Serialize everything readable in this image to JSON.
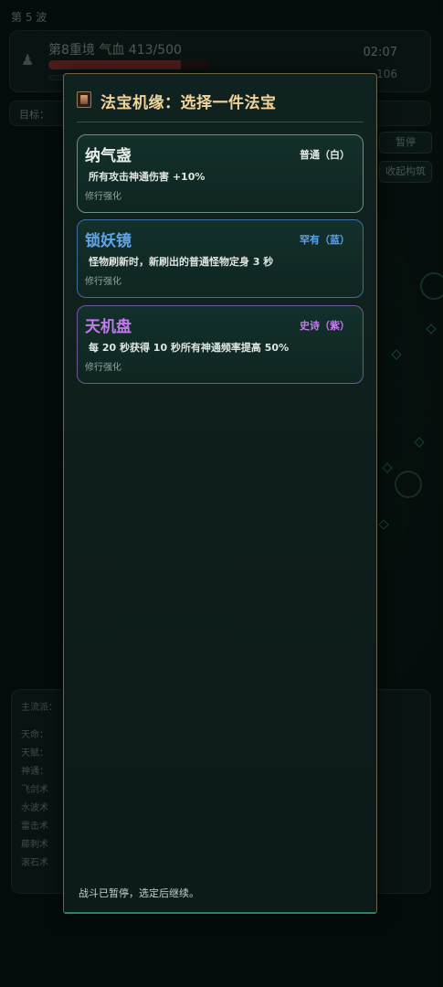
{
  "background": {
    "wave_label": "第 5 波",
    "stage_title": "第8重境  气血 413/500",
    "hp_fraction": 0.826,
    "timer": "02:07",
    "sub_stat": "106",
    "target_label": "目标：",
    "side_buttons": [
      "暂停",
      "收起构筑"
    ],
    "lower_panel": {
      "flow_label": "主流派：",
      "rows": [
        "天命：",
        "天赋：",
        "神通：",
        "飞剑术",
        "水波术",
        "雷击术",
        "藤刺术",
        "滚石术"
      ]
    }
  },
  "modal": {
    "title": "法宝机缘：选择一件法宝",
    "cards": [
      {
        "name": "纳气盏",
        "rarity": "普通（白）",
        "description": "所有攻击神通伤害 +10%",
        "tag": "修行强化",
        "color": "#e6ece8"
      },
      {
        "name": "锁妖镜",
        "rarity": "罕有（蓝）",
        "description": "怪物刷新时，新刷出的普通怪物定身 3 秒",
        "tag": "修行强化",
        "color": "#5fa3e8"
      },
      {
        "name": "天机盘",
        "rarity": "史诗（紫）",
        "description": "每 20 秒获得 10 秒所有神通频率提高 50%",
        "tag": "修行强化",
        "color": "#bf7ce8"
      }
    ],
    "footer": "战斗已暂停，选定后继续。"
  }
}
